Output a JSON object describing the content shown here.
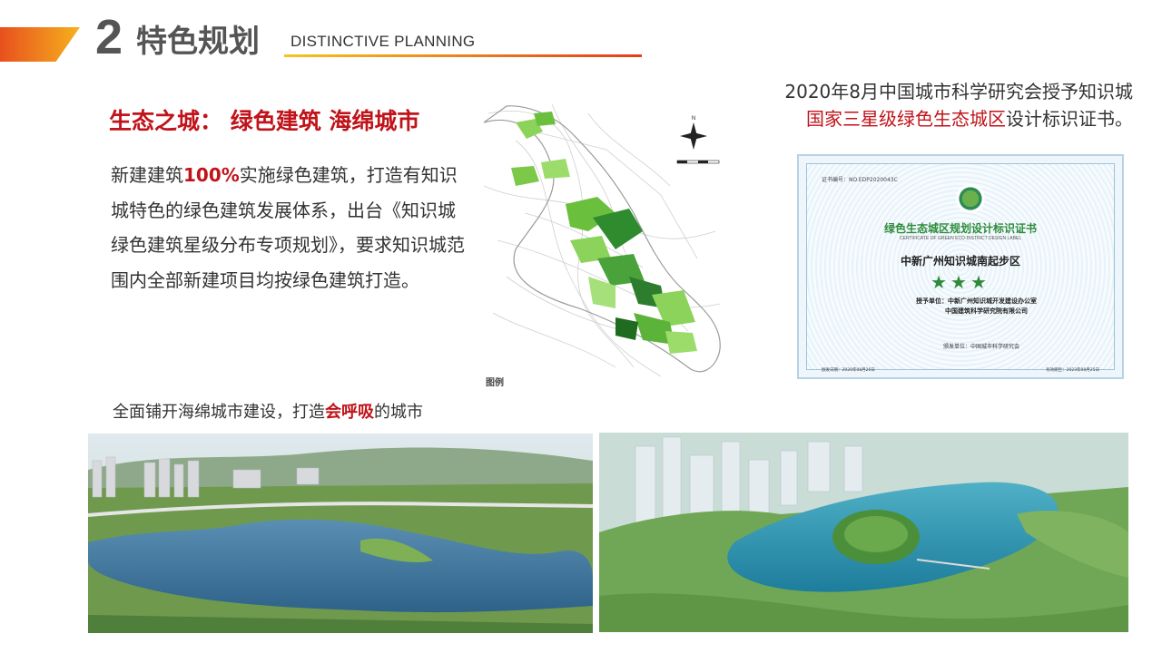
{
  "header": {
    "number": "2",
    "title": "特色规划",
    "subtitle": "DISTINCTIVE PLANNING"
  },
  "eco": {
    "title": "生态之城：  绿色建筑 海绵城市",
    "body_pre": "新建建筑",
    "body_hl": "100%",
    "body_post": "实施绿色建筑，打造有知识城特色的绿色建筑发展体系，出台《知识城绿色建筑星级分布专项规划》，要求知识城范围内全部新建项目均按绿色建筑打造。"
  },
  "map": {
    "legend_label": "图例"
  },
  "certificate_caption": {
    "line1": "2020年8月中国城市科学研究会授予知识城",
    "line2_red": "国家三星级绿色生态城区",
    "line2_rest": "设计标识证书。"
  },
  "certificate": {
    "number": "证书编号：NO.EDP2020043C",
    "title": "绿色生态城区规划设计标识证书",
    "title_en": "CERTIFICATE OF GREEN ECO-DISTRICT DESIGN LABEL",
    "project": "中新广州知识城南起步区",
    "stars": "★★★",
    "grantee_label": "授予单位：",
    "grantee_1": "中新广州知识城开发建设办公室",
    "grantee_2": "中国建筑科学研究院有限公司",
    "issuer": "颁发单位：中国城市科学研究会",
    "date_issue": "颁发日期：2020年08月26日",
    "date_valid": "有效期至：2023年08月25日"
  },
  "sponge": {
    "pre": "全面铺开海绵城市建设，打造",
    "hl": "会呼吸",
    "post": "的城市"
  },
  "colors": {
    "accent_red": "#c0131a",
    "accent_orange": "#e8501e",
    "accent_yellow": "#f6c31d",
    "green": "#2e8b3a"
  }
}
